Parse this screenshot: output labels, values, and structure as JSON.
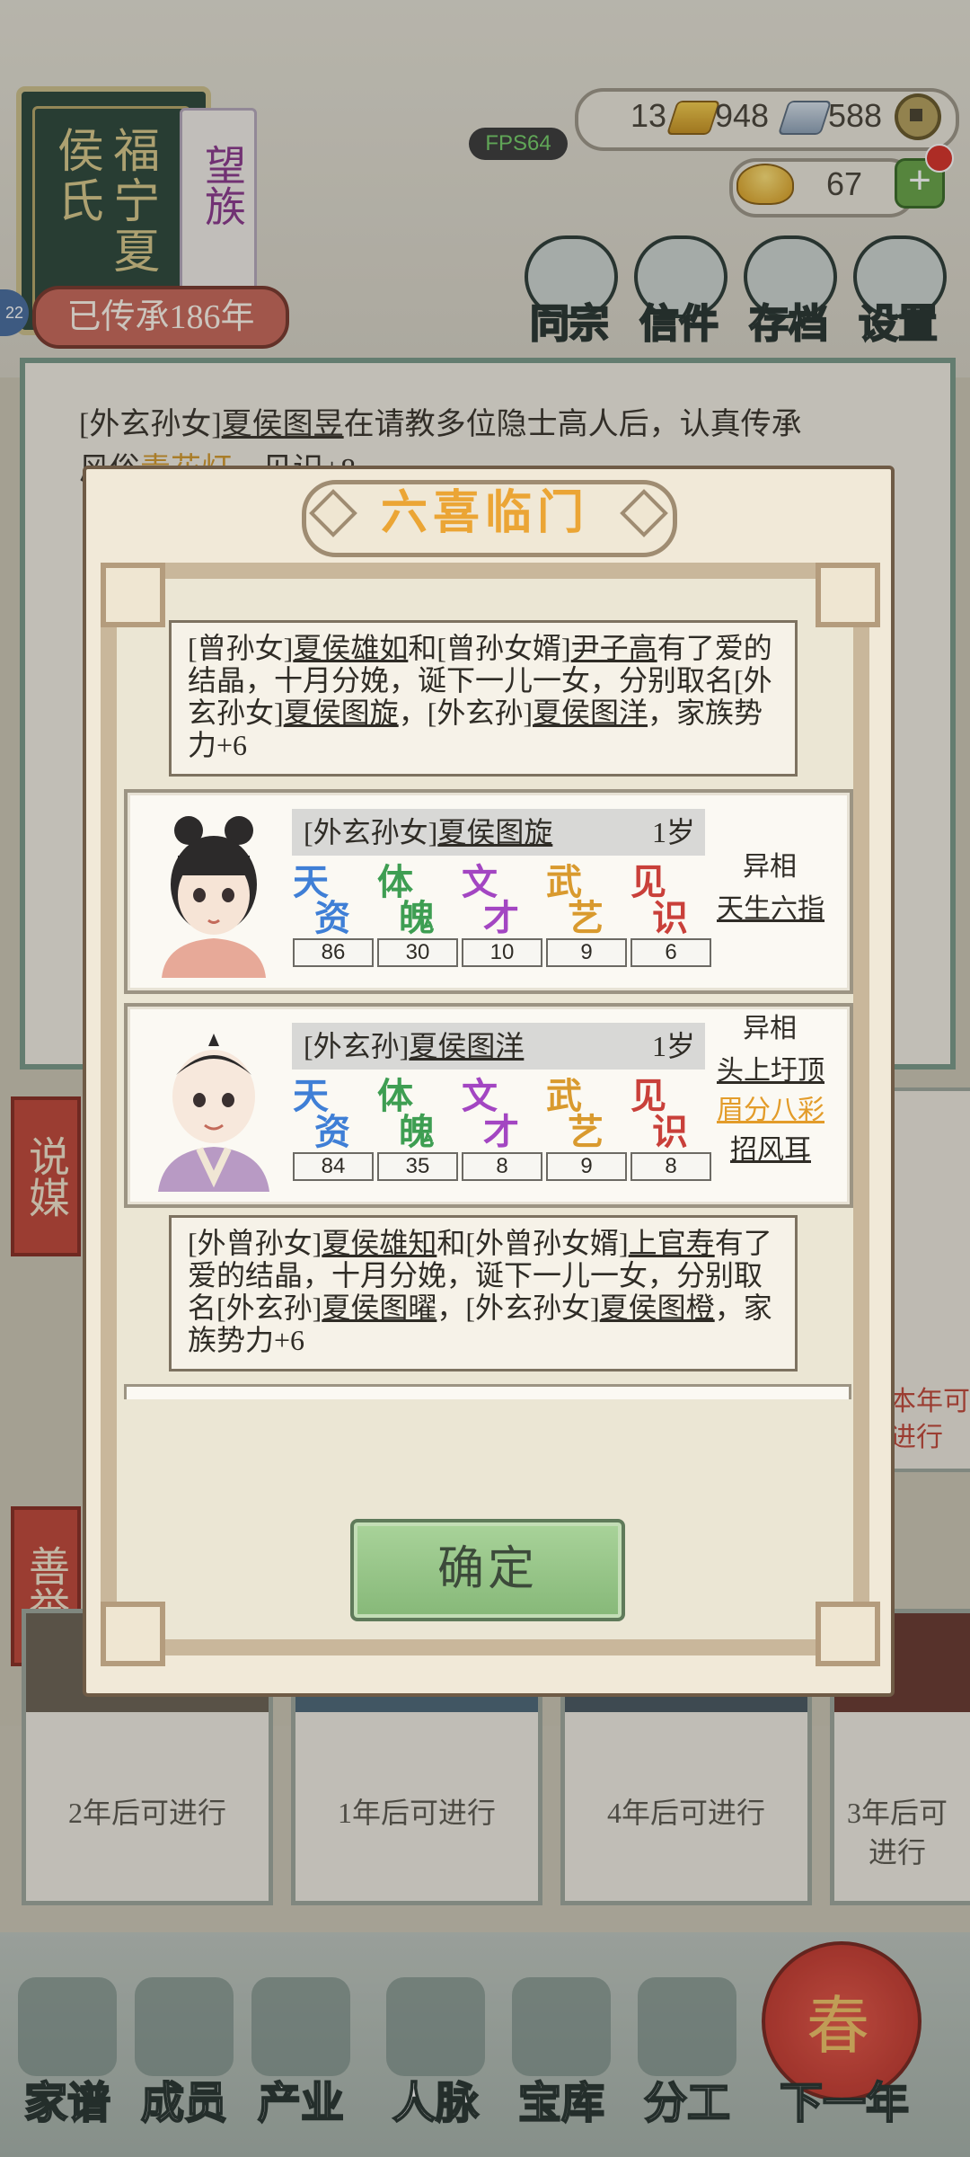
{
  "header": {
    "book_title": "福宁夏侯氏",
    "clan_tag": "望族",
    "heritage_label": "已传承186年",
    "side_badge": "22",
    "fps": "FPS64"
  },
  "resources": {
    "gold": "13",
    "silver": "948",
    "coins": "588",
    "ingots": "67"
  },
  "top_menu": [
    {
      "label": "同宗",
      "icon": "clan-icon"
    },
    {
      "label": "信件",
      "icon": "letter-icon"
    },
    {
      "label": "存档",
      "icon": "save-icon"
    },
    {
      "label": "设置",
      "icon": "gear-icon"
    }
  ],
  "log": {
    "prefix": "[外玄孙女]",
    "name": "夏侯图昱",
    "text1": "在请教多位隐士高人后，认真传承",
    "text2_a": "风俗",
    "text2_hl": "青花灯",
    "text2_b": "，见识+8"
  },
  "side_tabs": [
    "说媒",
    "善举"
  ],
  "side_card_text": "本年可进行",
  "cards": [
    {
      "label": "2年后可进行"
    },
    {
      "label": "1年后可进行"
    },
    {
      "label": "4年后可进行"
    },
    {
      "label": "3年后可进行"
    }
  ],
  "bottom_nav": [
    {
      "label": "家谱"
    },
    {
      "label": "成员"
    },
    {
      "label": "产业"
    },
    {
      "label": "人脉"
    },
    {
      "label": "宝库"
    },
    {
      "label": "分工"
    },
    {
      "label": "下一年"
    }
  ],
  "lantern": "春",
  "modal": {
    "title": "六喜临门",
    "confirm": "确定",
    "msg1": {
      "p1": "[曾孙女]",
      "n1": "夏侯雄如",
      "p2": "和[曾孙女婿]",
      "n2": "尹子高",
      "p3": "有了爱的结晶，十月分娩，诞下一儿一女，分别取名[外玄孙女]",
      "n3": "夏侯图旋",
      "p4": "，[外玄孙]",
      "n4": "夏侯图洋",
      "p5": "，家族势力+6"
    },
    "msg2": {
      "p1": "[外曾孙女]",
      "n1": "夏侯雄知",
      "p2": "和[外曾孙女婿]",
      "n2": "上官寿",
      "p3": "有了爱的结晶，十月分娩，诞下一儿一女，分别取名[外玄孙]",
      "n3": "夏侯图曜",
      "p4": "，[外玄孙女]",
      "n4": "夏侯图橙",
      "p5": "，家族势力+6"
    },
    "attr_labels": [
      {
        "name": "天资",
        "color": "#3f7fd6"
      },
      {
        "name": "体魄",
        "color": "#3e9e52"
      },
      {
        "name": "文才",
        "color": "#a346c2"
      },
      {
        "name": "武艺",
        "color": "#d99a2e"
      },
      {
        "name": "见识",
        "color": "#c9403a"
      }
    ],
    "children": [
      {
        "prefix": "[外玄孙女]",
        "name": "夏侯图旋",
        "age": "1岁",
        "stats": [
          "86",
          "30",
          "10",
          "9",
          "6"
        ],
        "trait_title": "异相",
        "traits": [
          {
            "text": "天生六指",
            "color": "#2f2c26"
          }
        ]
      },
      {
        "prefix": "[外玄孙]",
        "name": "夏侯图洋",
        "age": "1岁",
        "stats": [
          "84",
          "35",
          "8",
          "9",
          "8"
        ],
        "trait_title": "异相",
        "traits": [
          {
            "text": "头上圩顶",
            "color": "#2f2c26"
          },
          {
            "text": "眉分八彩",
            "color": "#e39c2a"
          },
          {
            "text": "招风耳",
            "color": "#2f2c26"
          }
        ]
      }
    ]
  }
}
